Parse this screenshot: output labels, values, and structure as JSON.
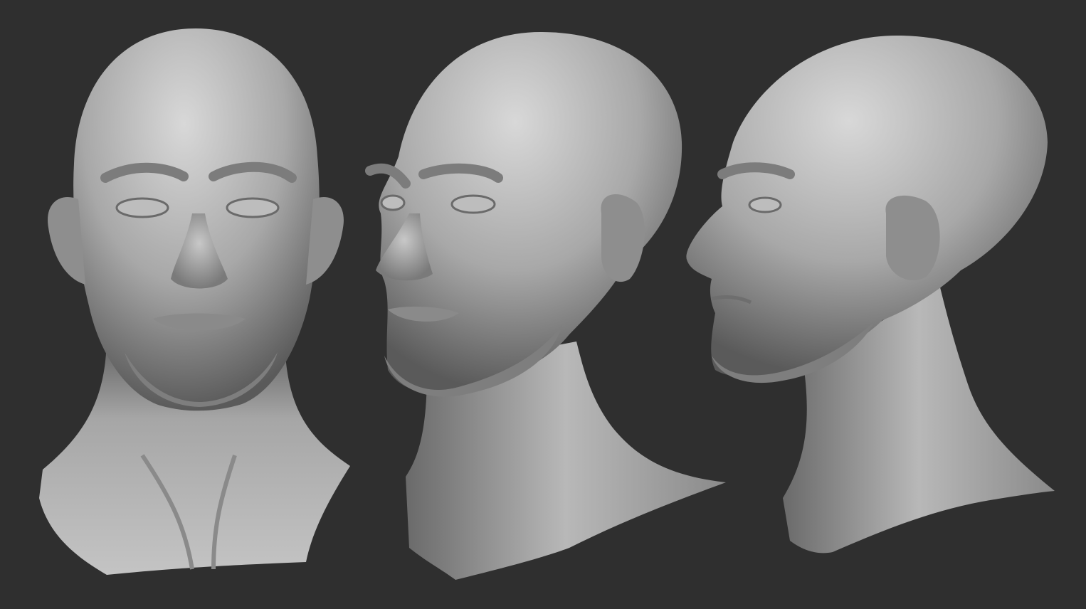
{
  "scene": {
    "background_color": "#2f2f2f",
    "clay_light": "#d2d2d2",
    "clay_mid": "#9a9a9a",
    "clay_dark": "#4a4a4a",
    "views": [
      {
        "name": "front-view",
        "angle": "front"
      },
      {
        "name": "three-quarter-view",
        "angle": "three-quarter"
      },
      {
        "name": "profile-view",
        "angle": "profile"
      }
    ]
  }
}
